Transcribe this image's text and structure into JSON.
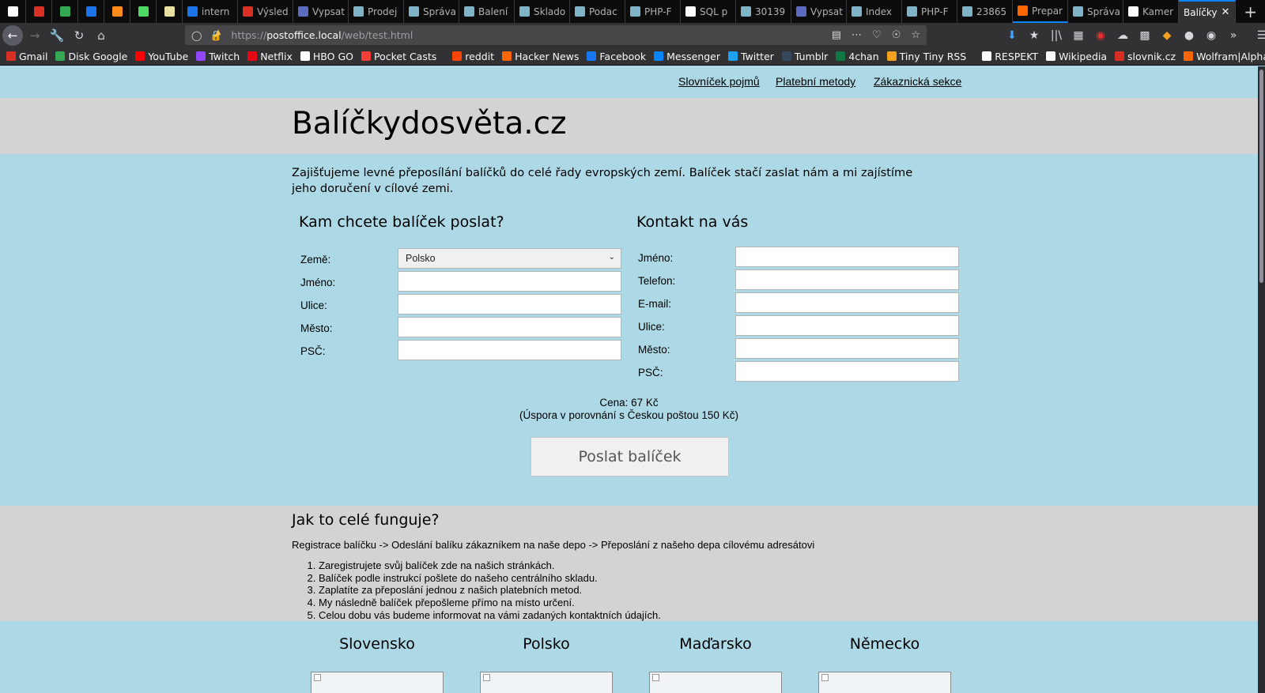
{
  "browser": {
    "tabs": [
      {
        "title": "",
        "favicon_color": "#ffffff",
        "kind": "icon-only"
      },
      {
        "title": "",
        "favicon_color": "#d93025",
        "kind": "icon-only"
      },
      {
        "title": "",
        "favicon_color": "#34a853",
        "kind": "icon-only"
      },
      {
        "title": "",
        "favicon_color": "#1a73e8",
        "kind": "icon-only"
      },
      {
        "title": "",
        "favicon_color": "#ff8c1a",
        "kind": "icon-only"
      },
      {
        "title": "",
        "favicon_color": "#4cd964",
        "kind": "icon-only"
      },
      {
        "title": "",
        "favicon_color": "#e8e0a0",
        "kind": "icon-only"
      },
      {
        "title": "intern",
        "favicon_color": "#1a73e8"
      },
      {
        "title": "Výsled",
        "favicon_color": "#d93025"
      },
      {
        "title": "Vypsat",
        "favicon_color": "#5c6bc0"
      },
      {
        "title": "Prodej",
        "favicon_color": "#7fb3c7"
      },
      {
        "title": "Správa",
        "favicon_color": "#7fb3c7"
      },
      {
        "title": "Balení",
        "favicon_color": "#7fb3c7"
      },
      {
        "title": "Sklado",
        "favicon_color": "#7fb3c7"
      },
      {
        "title": "Podac",
        "favicon_color": "#7fb3c7"
      },
      {
        "title": "PHP-F",
        "favicon_color": "#7fb3c7"
      },
      {
        "title": "SQL p",
        "favicon_color": "#ffffff"
      },
      {
        "title": "30139",
        "favicon_color": "#7fb3c7"
      },
      {
        "title": "Vypsat",
        "favicon_color": "#5c6bc0"
      },
      {
        "title": "Index",
        "favicon_color": "#7fb3c7"
      },
      {
        "title": "PHP-F",
        "favicon_color": "#7fb3c7"
      },
      {
        "title": "23865",
        "favicon_color": "#7fb3c7"
      },
      {
        "title": "Prepar",
        "favicon_color": "#ff6600"
      },
      {
        "title": "Správa",
        "favicon_color": "#7fb3c7"
      },
      {
        "title": "Kamer",
        "favicon_color": "#ffffff"
      },
      {
        "title": "Balíčky",
        "favicon_color": "",
        "active": true
      }
    ],
    "new_tab_label": "+",
    "url": {
      "scheme": "https://",
      "host": "postoffice.local",
      "path": "/web/test.html"
    },
    "bookmarks": [
      {
        "label": "Gmail",
        "icon": "gmail-icon",
        "color": "#d93025"
      },
      {
        "label": "Disk Google",
        "icon": "google-drive-icon",
        "color": "#34a853"
      },
      {
        "label": "YouTube",
        "icon": "youtube-icon",
        "color": "#ff0000"
      },
      {
        "label": "Twitch",
        "icon": "twitch-icon",
        "color": "#9146ff"
      },
      {
        "label": "Netflix",
        "icon": "netflix-icon",
        "color": "#e50914"
      },
      {
        "label": "HBO GO",
        "icon": "hbo-icon",
        "color": "#ffffff"
      },
      {
        "label": "Pocket Casts",
        "icon": "pocket-casts-icon",
        "color": "#f43e37"
      },
      {
        "label": "reddit",
        "icon": "reddit-icon",
        "color": "#ff4500"
      },
      {
        "label": "Hacker News",
        "icon": "hacker-news-icon",
        "color": "#ff6600"
      },
      {
        "label": "Facebook",
        "icon": "facebook-icon",
        "color": "#1877f2"
      },
      {
        "label": "Messenger",
        "icon": "messenger-icon",
        "color": "#0084ff"
      },
      {
        "label": "Twitter",
        "icon": "twitter-icon",
        "color": "#1da1f2"
      },
      {
        "label": "Tumblr",
        "icon": "tumblr-icon",
        "color": "#36465d"
      },
      {
        "label": "4chan",
        "icon": "4chan-icon",
        "color": "#117743"
      },
      {
        "label": "Tiny Tiny RSS",
        "icon": "rss-icon",
        "color": "#f4a21d"
      },
      {
        "label": "RESPEKT",
        "icon": "respekt-icon",
        "color": "#ffffff"
      },
      {
        "label": "Wikipedia",
        "icon": "wikipedia-icon",
        "color": "#ffffff"
      },
      {
        "label": "slovnik.cz",
        "icon": "slovnik-icon",
        "color": "#d93025"
      },
      {
        "label": "Wolfram|Alpha",
        "icon": "wolfram-icon",
        "color": "#ff6600"
      }
    ]
  },
  "page": {
    "nav": {
      "glossary": "Slovníček pojmů",
      "payment_methods": "Platební metody",
      "customer_section": "Zákaznická sekce"
    },
    "site_title": "Balíčkydosvěta.cz",
    "intro": "Zajišťujeme levné přeposílání balíčků do celé řady evropských zemí. Balíček stačí zaslat nám a mi zajístíme jeho doručení v cílové zemi.",
    "destination_form": {
      "heading": "Kam chcete balíček poslat?",
      "country_label": "Země:",
      "country_value": "Polsko",
      "name_label": "Jméno:",
      "street_label": "Ulice:",
      "city_label": "Město:",
      "zip_label": "PSČ:"
    },
    "contact_form": {
      "heading": "Kontakt na vás",
      "name_label": "Jméno:",
      "phone_label": "Telefon:",
      "email_label": "E-mail:",
      "street_label": "Ulice:",
      "city_label": "Město:",
      "zip_label": "PSČ:"
    },
    "price": "Cena: 67 Kč",
    "savings": "(Úspora v porovnání s Českou poštou 150 Kč)",
    "submit_label": "Poslat balíček",
    "how": {
      "title": "Jak to celé funguje?",
      "flow": "Registrace balíčku -> Odeslání balíku zákazníkem na naše depo -> Přeposlání z našeho depa cílovému adresátovi",
      "steps": [
        "Zaregistrujete svůj balíček zde na našich stránkách.",
        "Balíček podle instrukcí pošlete do našeho centrálního skladu.",
        "Zaplatíte za přeposlání jednou z našich platebních metod.",
        "My následně balíček přepošleme přímo na místo určení.",
        "Celou dobu vás budeme informovat na vámi zadaných kontaktních údajích."
      ]
    },
    "countries": [
      "Slovensko",
      "Polsko",
      "Maďarsko",
      "Německo"
    ]
  },
  "colors": {
    "page_background": "#add8e6",
    "band_background": "#d3d3d3",
    "tab_accent": "#0a84ff"
  }
}
